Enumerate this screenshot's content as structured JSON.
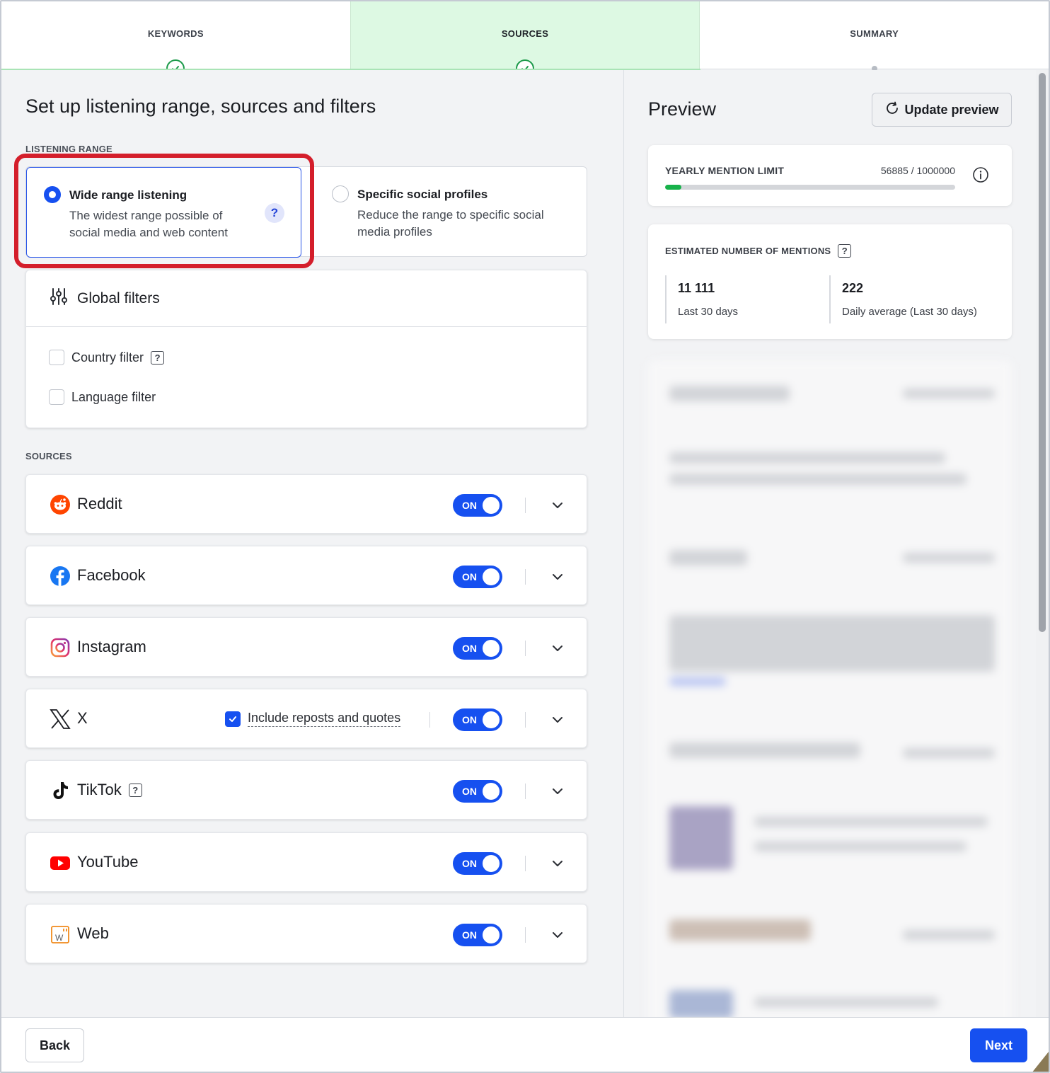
{
  "stepper": {
    "steps": [
      {
        "label": "KEYWORDS",
        "state": "done"
      },
      {
        "label": "SOURCES",
        "state": "active"
      },
      {
        "label": "SUMMARY",
        "state": "pending"
      }
    ]
  },
  "main": {
    "title": "Set up listening range, sources and filters",
    "listening_range_label": "LISTENING RANGE",
    "range_options": [
      {
        "title": "Wide range listening",
        "description": "The widest range possible of social media and web content",
        "selected": true,
        "help": "?"
      },
      {
        "title": "Specific social profiles",
        "description": "Reduce the range to specific social media profiles",
        "selected": false
      }
    ],
    "global_filters": {
      "title": "Global filters",
      "filters": [
        {
          "label": "Country filter",
          "checked": false,
          "help": "?"
        },
        {
          "label": "Language filter",
          "checked": false
        }
      ]
    },
    "sources_label": "SOURCES",
    "sources": [
      {
        "name": "Reddit",
        "icon": "reddit-icon",
        "toggle": "ON"
      },
      {
        "name": "Facebook",
        "icon": "facebook-icon",
        "toggle": "ON"
      },
      {
        "name": "Instagram",
        "icon": "instagram-icon",
        "toggle": "ON"
      },
      {
        "name": "X",
        "icon": "x-icon",
        "toggle": "ON",
        "extra_option": {
          "label": "Include reposts and quotes",
          "checked": true
        }
      },
      {
        "name": "TikTok",
        "icon": "tiktok-icon",
        "toggle": "ON",
        "help": "?"
      },
      {
        "name": "YouTube",
        "icon": "youtube-icon",
        "toggle": "ON"
      },
      {
        "name": "Web",
        "icon": "web-icon",
        "toggle": "ON",
        "icon_letter": "W"
      }
    ]
  },
  "preview": {
    "title": "Preview",
    "update_button": "Update preview",
    "yearly_limit": {
      "label": "YEARLY MENTION LIMIT",
      "value": "56885 / 1000000",
      "fraction": 0.0569
    },
    "estimated": {
      "label": "ESTIMATED NUMBER OF MENTIONS",
      "help": "?",
      "stats": [
        {
          "value": "11 111",
          "caption": "Last 30 days"
        },
        {
          "value": "222",
          "caption": "Daily average (Last 30 days)"
        }
      ]
    }
  },
  "footer": {
    "back": "Back",
    "next": "Next"
  },
  "colors": {
    "accent": "#1650f0",
    "success": "#1c9a4a",
    "active_step": "#ddf9e3",
    "highlight": "#d41e2b"
  }
}
